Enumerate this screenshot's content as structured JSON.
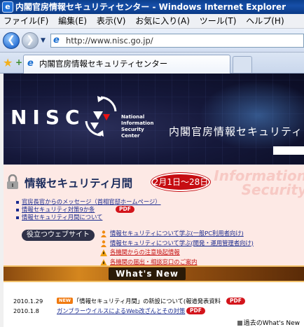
{
  "window": {
    "title": "内閣官房情報セキュリティセンター - Windows Internet Explorer"
  },
  "menubar": {
    "items": [
      "ファイル(F)",
      "編集(E)",
      "表示(V)",
      "お気に入り(A)",
      "ツール(T)",
      "ヘルプ(H)"
    ]
  },
  "navbar": {
    "address": "http://www.nisc.go.jp/"
  },
  "tabs": {
    "active_label": "内閣官房情報セキュリティセンター"
  },
  "banner": {
    "logo": "NISC",
    "org_en": [
      "National",
      "Information",
      "Security",
      "Center"
    ],
    "org_jp": "内閣官房情報セキュリティ"
  },
  "month": {
    "heading": "情報セキュリティ月間",
    "date_range": "2月1日〜28日",
    "bg_word": [
      "Information",
      "Security"
    ],
    "links": [
      "官房長官からのメッセージ（首相官邸ホームページ）",
      "情報セキュリティ対策9か条",
      "情報セキュリティ月間について"
    ],
    "pdf_label": "PDF"
  },
  "useful": {
    "title": "役立つウェブサイト",
    "links": [
      {
        "text": "情報セキュリティについて学ぶ(一般PC利用者向け)",
        "icon": "person-icon"
      },
      {
        "text": "情報セキュリティについて学ぶ(開発・運用管理者向け)",
        "icon": "person-icon"
      },
      {
        "text": "各機関からの注意喚起情報",
        "icon": "warning-icon"
      },
      {
        "text": "各機関の届出・相談窓口のご案内",
        "icon": "warning-icon"
      }
    ]
  },
  "whats_new": {
    "title": "What's  New"
  },
  "news": {
    "items": [
      {
        "date": "2010.1.29",
        "badge": "NEW",
        "text": "「情報セキュリティ月間」の新設について(報道発表資料",
        "pdf": "PDF"
      },
      {
        "date": "2010.1.8",
        "badge": "",
        "text": "ガンブラーウイルスによるWeb改ざんとその対策",
        "pdf": "PDF"
      }
    ],
    "prev_label": "過去のWhat's New"
  }
}
